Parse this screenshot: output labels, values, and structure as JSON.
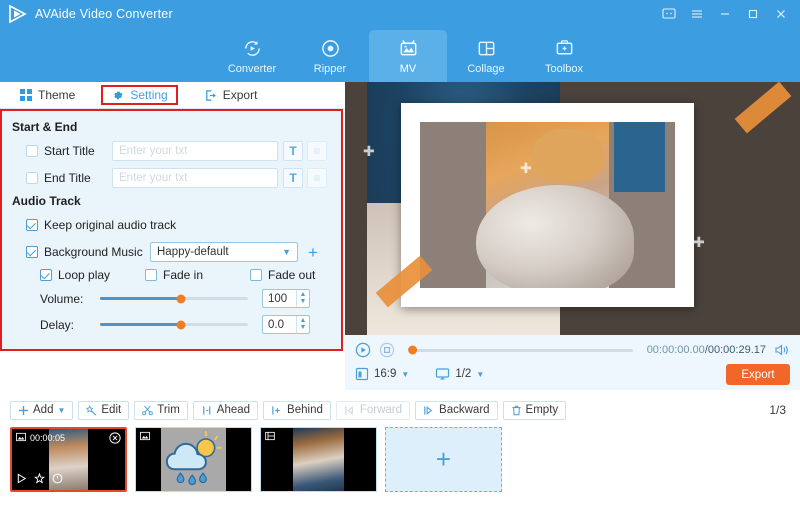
{
  "window": {
    "app_title": "AVAide Video Converter",
    "logo_icon": "play-triangle-logo",
    "controls": [
      {
        "name": "feedback-icon",
        "glyph": "⌨"
      },
      {
        "name": "menu-icon",
        "glyph": "☰"
      },
      {
        "name": "minimize-icon",
        "glyph": "—"
      },
      {
        "name": "maximize-icon",
        "glyph": "□"
      },
      {
        "name": "close-icon",
        "glyph": "✕"
      }
    ],
    "accent_color": "#3c9ee0",
    "export_color": "#f2662a",
    "highlight_color": "#e02020"
  },
  "topnav": {
    "items": [
      {
        "label": "Converter",
        "icon": "convert-arrows-icon",
        "active": false
      },
      {
        "label": "Ripper",
        "icon": "disc-icon",
        "active": false
      },
      {
        "label": "MV",
        "icon": "mv-picture-icon",
        "active": true
      },
      {
        "label": "Collage",
        "icon": "collage-grid-icon",
        "active": false
      },
      {
        "label": "Toolbox",
        "icon": "toolbox-icon",
        "active": false
      }
    ]
  },
  "subtabs": {
    "items": [
      {
        "label": "Theme",
        "icon": "grid-squares-icon",
        "selected": false
      },
      {
        "label": "Setting",
        "icon": "gear-icon",
        "selected": true
      },
      {
        "label": "Export",
        "icon": "export-arrow-icon",
        "selected": false
      }
    ]
  },
  "settings": {
    "start_end": {
      "section_title": "Start & End",
      "rows": [
        {
          "label": "Start Title",
          "checked": false,
          "placeholder": "Enter your txt",
          "value": "",
          "buttons": [
            {
              "name": "text-style-button",
              "glyph": "T",
              "enabled": true
            },
            {
              "name": "text-options-button",
              "glyph": "≡",
              "enabled": false
            }
          ]
        },
        {
          "label": "End Title",
          "checked": false,
          "placeholder": "Enter your txt",
          "value": "",
          "buttons": [
            {
              "name": "text-style-button",
              "glyph": "T",
              "enabled": true
            },
            {
              "name": "text-options-button",
              "glyph": "≡",
              "enabled": false
            }
          ]
        }
      ]
    },
    "audio_track": {
      "section_title": "Audio Track",
      "keep_original": {
        "label": "Keep original audio track",
        "checked": true
      },
      "background_music": {
        "label": "Background Music",
        "checked": true,
        "selected_option": "Happy-default",
        "add_label": "+"
      },
      "loop_play": {
        "label": "Loop play",
        "checked": true
      },
      "fade_in": {
        "label": "Fade in",
        "checked": false
      },
      "fade_out": {
        "label": "Fade out",
        "checked": false
      },
      "volume": {
        "label": "Volume:",
        "value": "100",
        "percent": 55
      },
      "delay": {
        "label": "Delay:",
        "value": "0.0",
        "percent": 55
      }
    }
  },
  "preview": {
    "theme_name": "photo-frame-theme",
    "decor": [
      "orange-tape-top-right",
      "orange-tape-bottom-left",
      "sparkle-left",
      "sparkle-center",
      "sparkle-right"
    ]
  },
  "player": {
    "play_icon": "play-circle-icon",
    "stop_icon": "stop-circle-icon",
    "current_time": "00:00:00.00",
    "separator": "/",
    "total_time": "00:00:29.17",
    "volume_icon": "speaker-icon",
    "aspect_ratio": {
      "icon": "aspect-ratio-icon",
      "value": "16:9"
    },
    "screen_scale": {
      "icon": "monitor-icon",
      "value": "1/2"
    },
    "export_label": "Export"
  },
  "toolbar": {
    "buttons": [
      {
        "label": "Add",
        "icon": "plus-icon",
        "enabled": true,
        "has_caret": true
      },
      {
        "label": "Edit",
        "icon": "magic-wand-icon",
        "enabled": true,
        "has_caret": false
      },
      {
        "label": "Trim",
        "icon": "scissors-icon",
        "enabled": true,
        "has_caret": false
      },
      {
        "label": "Ahead",
        "icon": "insert-ahead-icon",
        "enabled": true,
        "has_caret": false
      },
      {
        "label": "Behind",
        "icon": "insert-behind-icon",
        "enabled": true,
        "has_caret": false
      },
      {
        "label": "Forward",
        "icon": "move-forward-icon",
        "enabled": false,
        "has_caret": false
      },
      {
        "label": "Backward",
        "icon": "move-backward-icon",
        "enabled": true,
        "has_caret": false
      },
      {
        "label": "Empty",
        "icon": "trash-icon",
        "enabled": true,
        "has_caret": false
      }
    ],
    "page_count": "1/3"
  },
  "timeline": {
    "clips": [
      {
        "type": "video",
        "duration": "00:00:05",
        "badge_icon": "image-icon",
        "selected": true,
        "close_icon": "close-circle-icon",
        "tools": [
          "play-icon",
          "star-icon",
          "clock-icon"
        ]
      },
      {
        "type": "image",
        "duration": "",
        "badge_icon": "image-icon",
        "selected": false
      },
      {
        "type": "video",
        "duration": "",
        "badge_icon": "film-icon",
        "selected": false
      }
    ],
    "add_tile": {
      "label": "+",
      "name": "add-clip-tile"
    }
  }
}
